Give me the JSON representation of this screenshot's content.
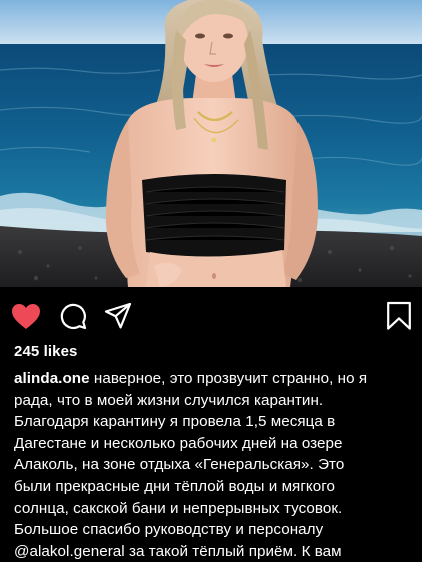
{
  "post": {
    "photo_alt": "",
    "likes": "245 likes",
    "caption": {
      "username": "alinda.one",
      "first_line_text": " наверное, это прозвучит странно, но я",
      "lines": [
        "рада, что в моей жизни случился карантин.",
        "Благодаря карантину я провела 1,5 месяца в",
        "Дагестане и несколько рабочих дней на озере",
        "Алаколь, на зоне отдыха «Генеральская». Это",
        "были прекрасные дни тёплой воды и мягкого",
        "солнца, сакской бани и непрерывных тусовок.",
        "Большое спасибо руководству и персоналу",
        "@alakol.general за такой тёплый приём. К вам"
      ]
    }
  },
  "icons": {
    "like": "heart-icon",
    "comment": "comment-icon",
    "share": "paper-plane-icon",
    "save": "bookmark-icon"
  },
  "colors": {
    "background": "#000000",
    "text": "#ffffff",
    "like_active": "#ed4956"
  }
}
